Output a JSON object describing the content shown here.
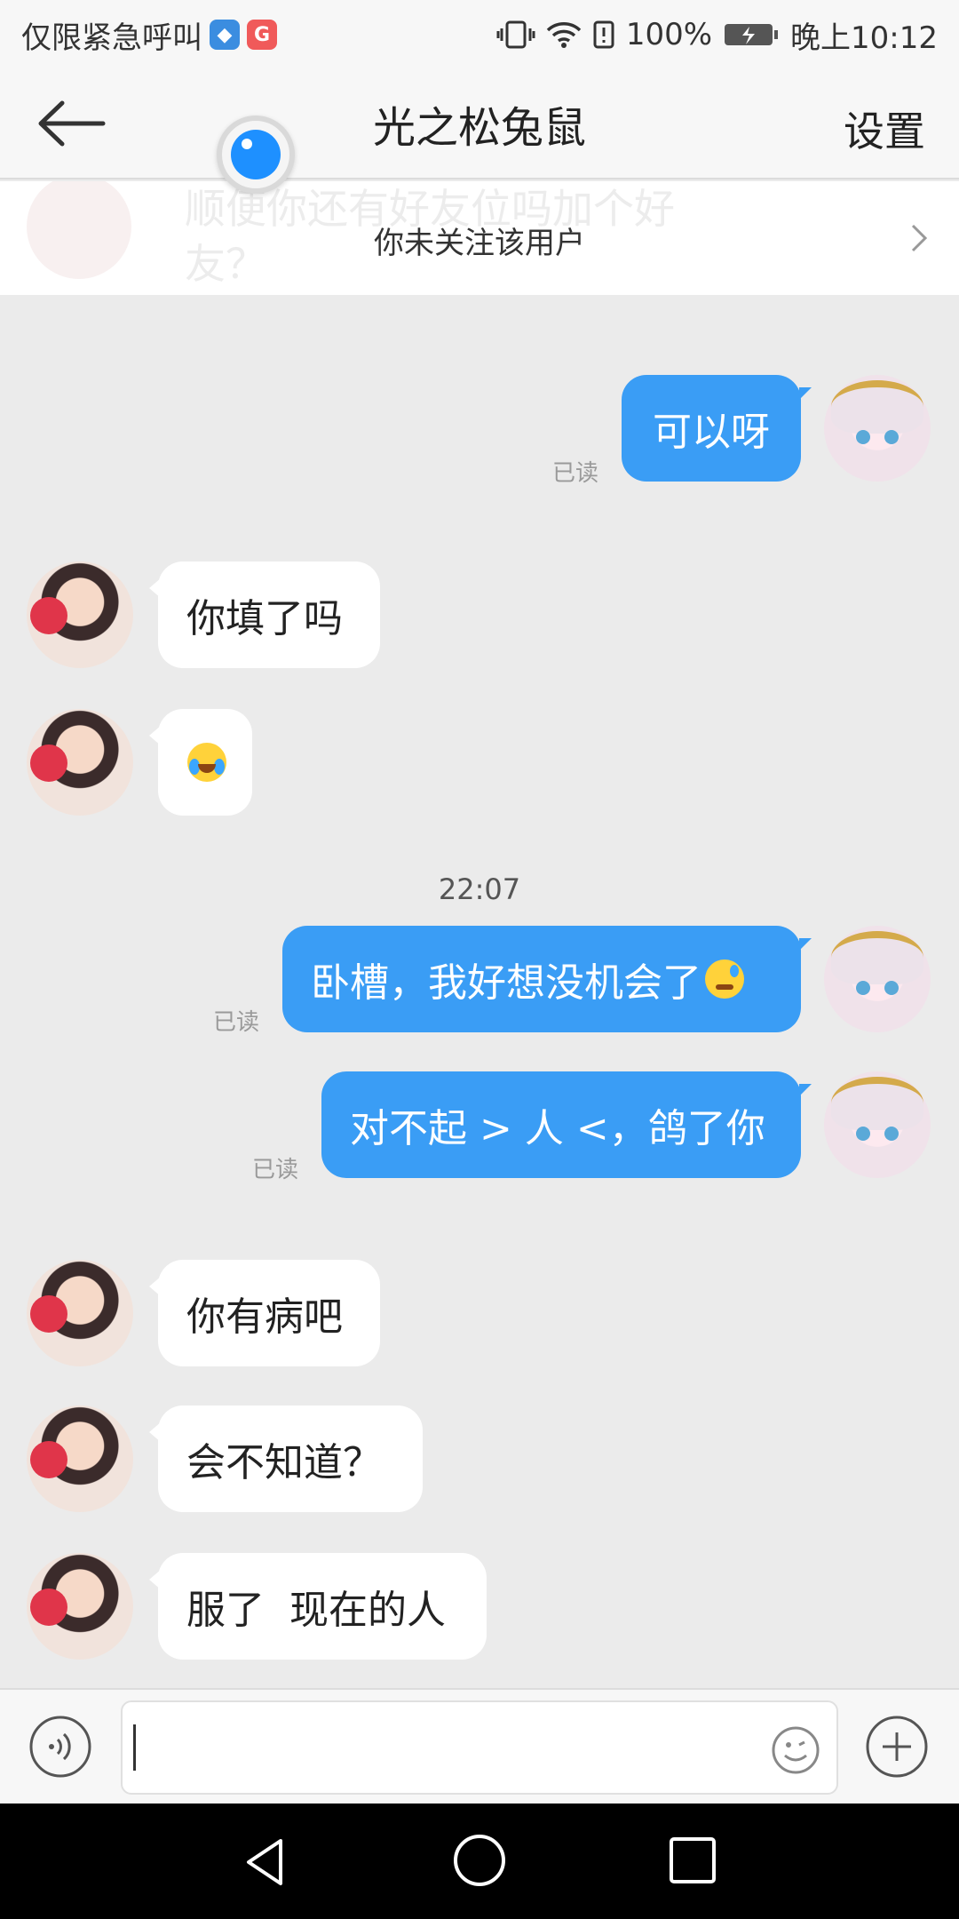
{
  "status_bar": {
    "carrier": "仅限紧急呼叫",
    "battery": "100%",
    "time": "晚上10:12"
  },
  "header": {
    "title": "光之松兔鼠",
    "settings": "设置"
  },
  "banner": {
    "ghost_text": "顺便你还有好友位吗加个好友？",
    "follow_text": "你未关注该用户"
  },
  "messages": [
    {
      "sender": "me",
      "text": "可以呀",
      "read": "已读"
    },
    {
      "sender": "them",
      "text": "你填了吗"
    },
    {
      "sender": "them",
      "emoji": "crying-laughing-emoji"
    },
    {
      "timestamp": "22:07"
    },
    {
      "sender": "me",
      "text": "卧槽，我好想没机会了",
      "emoji": "sleepy-face-emoji",
      "read": "已读"
    },
    {
      "sender": "me",
      "text": "对不起 > 人 <，鸽了你",
      "read": "已读"
    },
    {
      "sender": "them",
      "text": "你有病吧"
    },
    {
      "sender": "them",
      "text": "会不知道？"
    },
    {
      "sender": "them",
      "text": "服了  现在的人"
    }
  ],
  "input": {
    "value": "",
    "placeholder": ""
  },
  "colors": {
    "accent": "#3a9df5",
    "background": "#ebebeb",
    "bubble_them": "#ffffff"
  }
}
